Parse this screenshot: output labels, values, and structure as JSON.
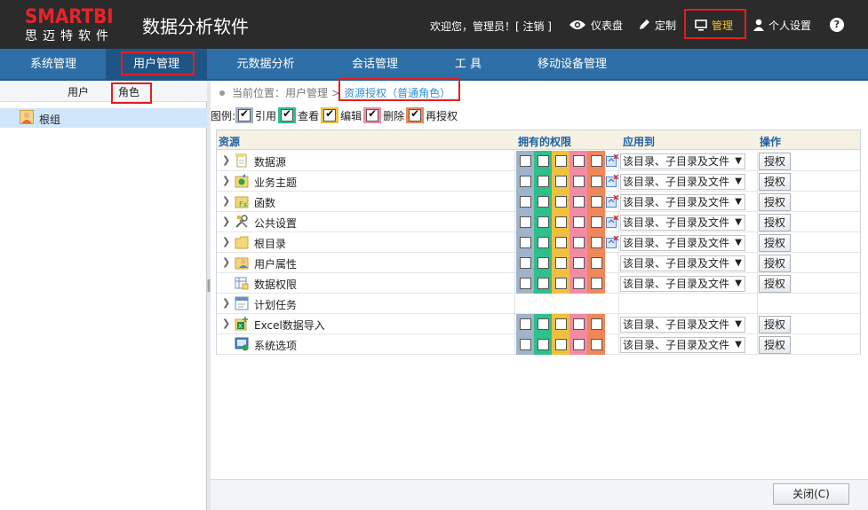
{
  "header": {
    "logo_main": "SMARTBI",
    "logo_sub": "思迈特软件",
    "app_title": "数据分析软件",
    "welcome": "欢迎您，管理员！[ 注销 ]",
    "nav": [
      {
        "label": "仪表盘",
        "icon": "eye-icon"
      },
      {
        "label": "定制",
        "icon": "pencil-icon"
      },
      {
        "label": "管理",
        "icon": "monitor-icon"
      },
      {
        "label": "个人设置",
        "icon": "user-icon"
      }
    ],
    "help": "?",
    "manage_label_color": "#f5c518"
  },
  "mainnav": [
    "系统管理",
    "用户管理",
    "元数据分析",
    "会话管理",
    "工 具",
    "移动设备管理"
  ],
  "left": {
    "tabs": [
      "用户",
      "角色"
    ],
    "tree": [
      {
        "label": "根组",
        "icon": "user-group-icon"
      }
    ]
  },
  "breadcrumb": {
    "prefix": "当前位置：用户管理",
    "sep": ">",
    "current": "资源授权（普通角色）"
  },
  "legend": {
    "title": "图例:",
    "items": [
      {
        "label": "引用",
        "color": "#9fb3c9"
      },
      {
        "label": "查看",
        "color": "#2fbf8a"
      },
      {
        "label": "编辑",
        "color": "#f0c040"
      },
      {
        "label": "删除",
        "color": "#f28ca3"
      },
      {
        "label": "再授权",
        "color": "#f0875a"
      }
    ]
  },
  "table": {
    "headers": {
      "resource": "资源",
      "perms": "拥有的权限",
      "apply": "应用到",
      "action": "操作"
    },
    "rows": [
      {
        "label": "数据源",
        "icon": "datasource-icon",
        "arrow": true,
        "perms": true,
        "mini": true,
        "apply": "该目录、子目录及文件",
        "action": "授权"
      },
      {
        "label": "业务主题",
        "icon": "business-theme-icon",
        "arrow": true,
        "perms": true,
        "mini": true,
        "apply": "该目录、子目录及文件",
        "action": "授权"
      },
      {
        "label": "函数",
        "icon": "function-icon",
        "arrow": true,
        "perms": true,
        "mini": true,
        "apply": "该目录、子目录及文件",
        "action": "授权"
      },
      {
        "label": "公共设置",
        "icon": "tools-icon",
        "arrow": true,
        "perms": true,
        "mini": true,
        "apply": "该目录、子目录及文件",
        "action": "授权"
      },
      {
        "label": "根目录",
        "icon": "folder-icon",
        "arrow": true,
        "perms": true,
        "mini": true,
        "apply": "该目录、子目录及文件",
        "action": "授权"
      },
      {
        "label": "用户属性",
        "icon": "user-attr-icon",
        "arrow": true,
        "perms": true,
        "mini": false,
        "apply": "该目录、子目录及文件",
        "action": "授权"
      },
      {
        "label": "数据权限",
        "icon": "data-permission-icon",
        "arrow": false,
        "perms": true,
        "mini": false,
        "apply": "该目录、子目录及文件",
        "action": "授权"
      },
      {
        "label": "计划任务",
        "icon": "schedule-icon",
        "arrow": true,
        "perms": false,
        "mini": false,
        "apply": "",
        "action": ""
      },
      {
        "label": "Excel数据导入",
        "icon": "excel-import-icon",
        "arrow": true,
        "perms": true,
        "mini": false,
        "apply": "该目录、子目录及文件",
        "action": "授权"
      },
      {
        "label": "系统选项",
        "icon": "system-options-icon",
        "arrow": false,
        "perms": true,
        "mini": false,
        "apply": "该目录、子目录及文件",
        "action": "授权"
      }
    ]
  },
  "footer": {
    "close": "关闭(C)"
  }
}
